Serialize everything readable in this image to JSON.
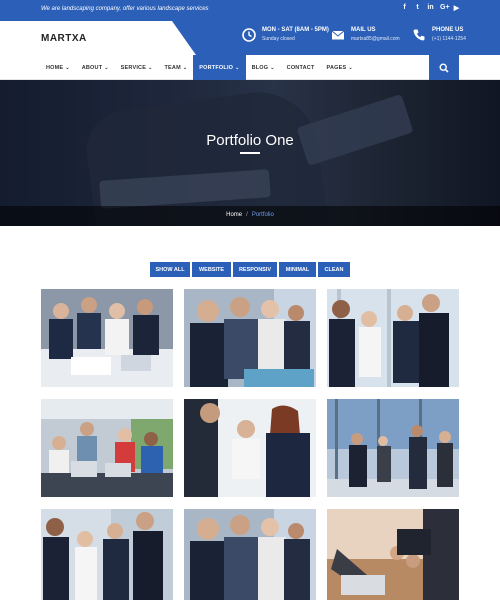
{
  "topbar": {
    "tagline": "We are landscaping company, offer various landscape services",
    "socials": [
      {
        "icon": "facebook-icon",
        "glyph": "f"
      },
      {
        "icon": "twitter-icon",
        "glyph": "t"
      },
      {
        "icon": "linkedin-icon",
        "glyph": "in"
      },
      {
        "icon": "google-plus-icon",
        "glyph": "G+"
      },
      {
        "icon": "youtube-icon",
        "glyph": "▶"
      }
    ]
  },
  "header": {
    "logo": "MARTXA",
    "hours": {
      "title": "MON - SAT (8AM - 5PM)",
      "sub": "Sunday closed"
    },
    "mail": {
      "title": "MAIL US",
      "sub": "martxa85@gmail.com"
    },
    "phone": {
      "title": "PHONE US",
      "sub": "(+1) 1144-1254"
    }
  },
  "nav": {
    "items": [
      {
        "label": "HOME",
        "caret": true
      },
      {
        "label": "ABOUT",
        "caret": true
      },
      {
        "label": "SERVICE",
        "caret": true
      },
      {
        "label": "TEAM",
        "caret": true
      },
      {
        "label": "PORTFOLIO",
        "caret": true,
        "active": true
      },
      {
        "label": "BLOG",
        "caret": true
      },
      {
        "label": "CONTACT",
        "caret": false
      },
      {
        "label": "PAGES",
        "caret": true
      }
    ]
  },
  "hero": {
    "title": "Portfolio One",
    "breadcrumb": {
      "home": "Home",
      "separator": "/",
      "current": "Portfolio"
    }
  },
  "filters": [
    "SHOW ALL",
    "WEBSITE",
    "RESPONSIV",
    "MINIMAL",
    "CLEAN"
  ],
  "colors": {
    "accent": "#2b5fb8",
    "dark": "#1b2130"
  }
}
